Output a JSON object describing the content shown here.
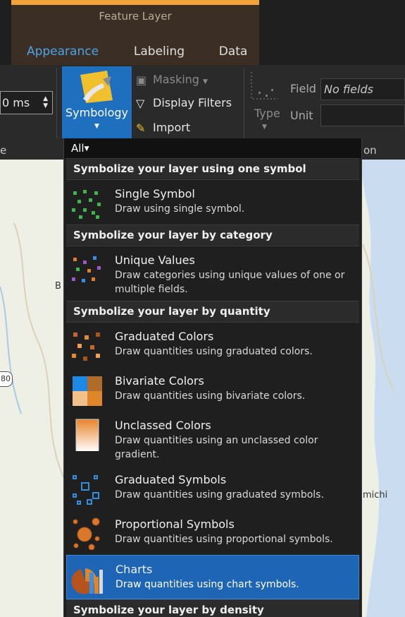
{
  "ribbon": {
    "context_title": "Feature Layer",
    "tabs": [
      {
        "label": "Appearance",
        "active": true
      },
      {
        "label": "Labeling",
        "active": false
      },
      {
        "label": "Data",
        "active": false
      }
    ],
    "spinner_value": "0 ms",
    "left_group_label": "e",
    "symbology_label": "Symbology",
    "masking_label": "Masking",
    "display_filters_label": "Display Filters",
    "import_label": "Import",
    "type_label": "Type",
    "field_label": "Field",
    "field_value": "No fields",
    "unit_label": "Unit",
    "unit_value": "",
    "right_group_label": "on"
  },
  "map": {
    "labels": [
      "B",
      "80",
      "michi"
    ]
  },
  "dropdown": {
    "filter": "All",
    "sections": [
      {
        "title": "Symbolize your layer using one symbol",
        "items": [
          {
            "name": "Single Symbol",
            "desc": "Draw using single symbol.",
            "icon": "single-symbol-icon"
          }
        ]
      },
      {
        "title": "Symbolize your layer by category",
        "items": [
          {
            "name": "Unique Values",
            "desc": "Draw categories using unique values of one or multiple fields.",
            "icon": "unique-values-icon"
          }
        ]
      },
      {
        "title": "Symbolize your layer by quantity",
        "items": [
          {
            "name": "Graduated Colors",
            "desc": "Draw quantities using graduated colors.",
            "icon": "graduated-colors-icon"
          },
          {
            "name": "Bivariate Colors",
            "desc": "Draw quantities using bivariate colors.",
            "icon": "bivariate-colors-icon"
          },
          {
            "name": "Unclassed Colors",
            "desc": "Draw quantities using an unclassed color gradient.",
            "icon": "unclassed-colors-icon"
          },
          {
            "name": "Graduated Symbols",
            "desc": "Draw quantities using graduated symbols.",
            "icon": "graduated-symbols-icon"
          },
          {
            "name": "Proportional Symbols",
            "desc": "Draw quantities using proportional symbols.",
            "icon": "proportional-symbols-icon"
          },
          {
            "name": "Charts",
            "desc": "Draw quantities using chart symbols.",
            "icon": "charts-icon",
            "selected": true
          }
        ]
      },
      {
        "title": "Symbolize your layer by density",
        "items": []
      }
    ]
  },
  "colors": {
    "accent_blue": "#1e66b5",
    "context_orange": "#f2a33a",
    "tab_active": "#4aa3e8"
  }
}
